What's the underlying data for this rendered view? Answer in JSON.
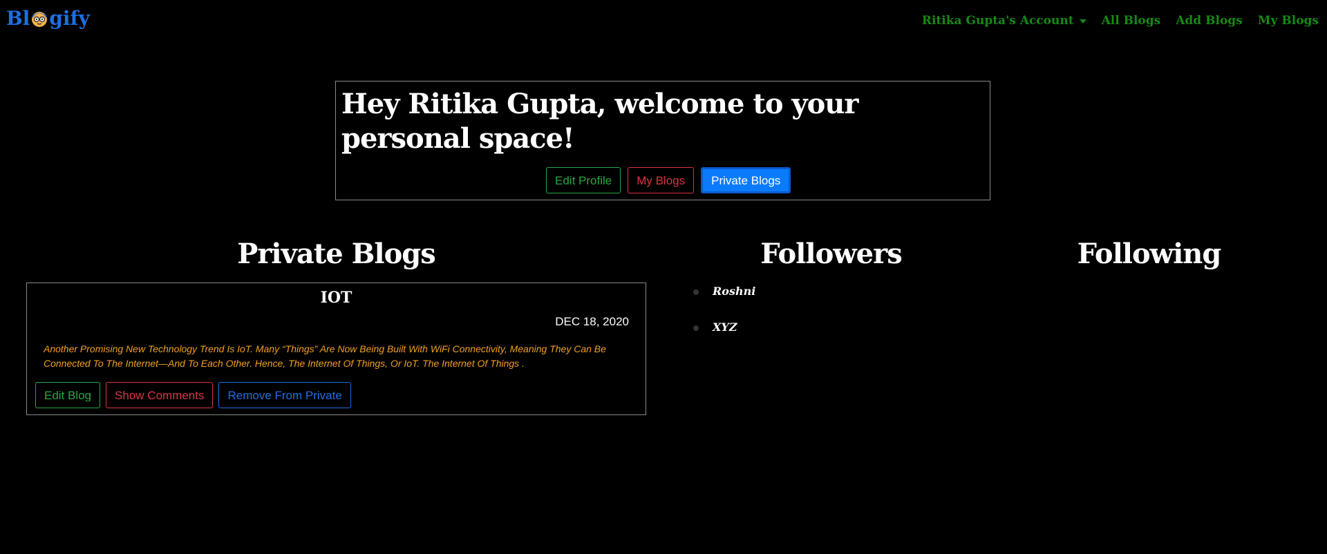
{
  "navbar": {
    "brand": {
      "prefix": "Bl",
      "suffix": "gify"
    },
    "links": [
      "Ritika Gupta's Account",
      "All Blogs",
      "Add Blogs",
      "My Blogs"
    ]
  },
  "welcome": {
    "heading": "Hey Ritika Gupta, welcome to your personal space!",
    "buttons": [
      "Edit Profile",
      "My Blogs",
      "Private Blogs"
    ]
  },
  "private_blogs": {
    "title": "Private Blogs",
    "blog": {
      "title": "IOT",
      "date": "DEC 18, 2020",
      "description": "Another Promising New Technology Trend Is IoT. Many “Things” Are Now Being Built With WiFi Connectivity, Meaning They Can Be Connected To The Internet—And To Each Other. Hence, The Internet Of Things, Or IoT. The Internet Of Things .",
      "buttons": [
        "Edit Blog",
        "Show Comments",
        "Remove From Private"
      ]
    }
  },
  "followers": {
    "title": "Followers",
    "items": [
      "Roshni",
      "XYZ"
    ]
  },
  "following": {
    "title": "Following"
  },
  "colors": {
    "accent_blue": "#0a7bff",
    "nav_green": "#158a15",
    "desc_orange": "#f0a020"
  }
}
